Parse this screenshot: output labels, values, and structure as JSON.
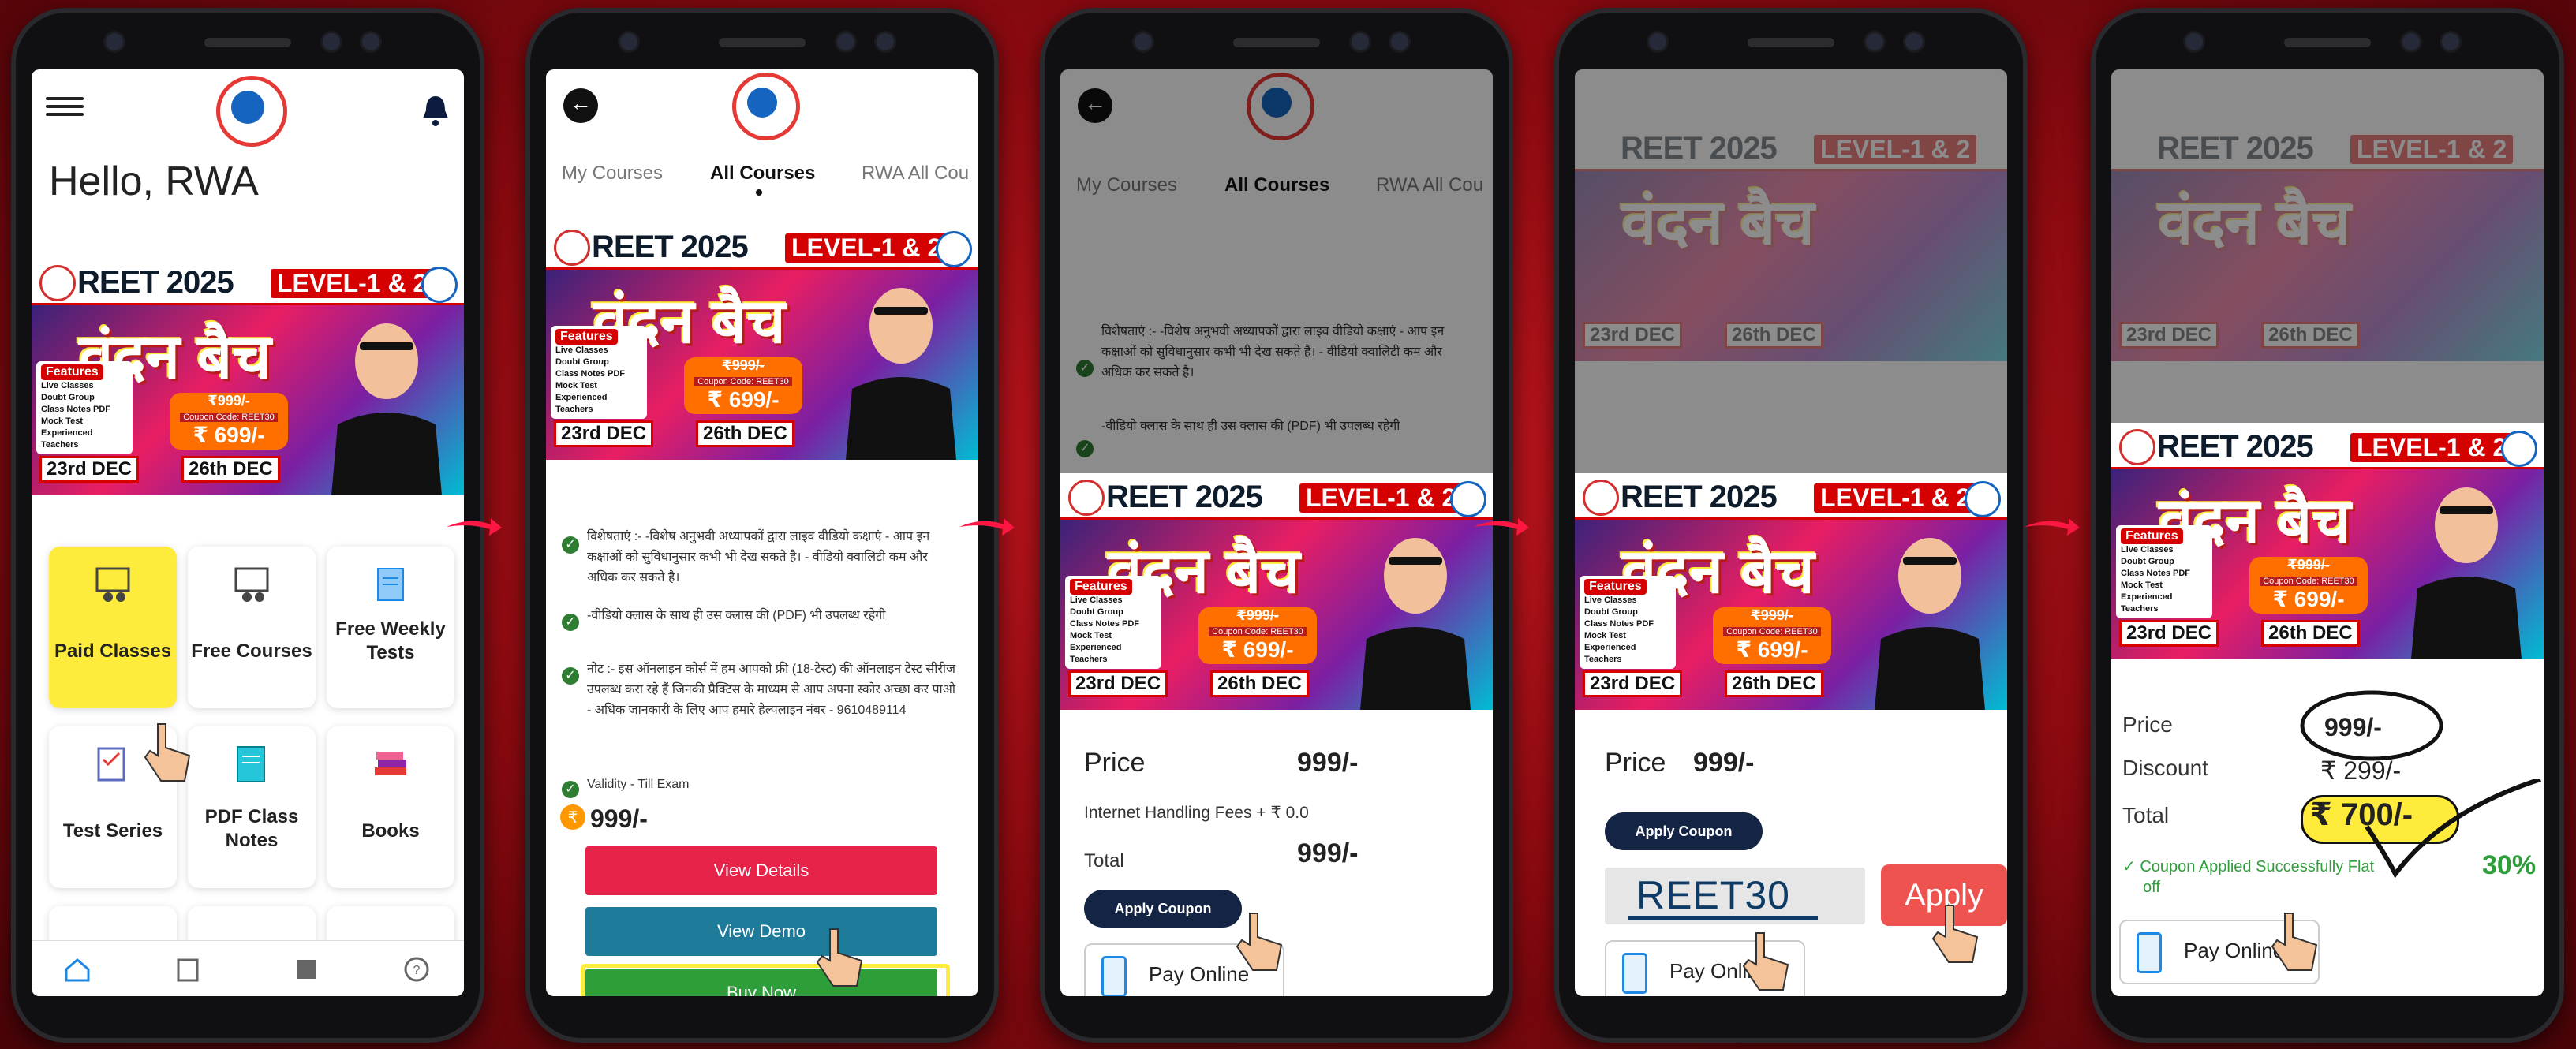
{
  "banner": {
    "reet": "REET 2025",
    "level": "LEVEL-1 & 2",
    "title": "वंदन बैच",
    "features_title": "Features",
    "features": [
      "Live Classes",
      "Doubt Group",
      "Class Notes PDF",
      "Mock Test",
      "Experienced Teachers"
    ],
    "price_old": "₹999/-",
    "coupon_line": "Coupon Code: REET30",
    "price_new": "₹ 699/-",
    "date_start": "23rd DEC",
    "date_end": "26th DEC"
  },
  "screen1": {
    "greeting": "Hello, RWA",
    "tiles": [
      {
        "label": "Paid Classes",
        "icon": "paid-classes-icon"
      },
      {
        "label": "Free Courses",
        "icon": "free-courses-icon"
      },
      {
        "label": "Free Weekly Tests",
        "icon": "weekly-tests-icon"
      },
      {
        "label": "Test Series",
        "icon": "test-series-icon"
      },
      {
        "label": "PDF Class Notes",
        "icon": "pdf-notes-icon"
      },
      {
        "label": "Books",
        "icon": "books-icon"
      }
    ]
  },
  "tabs": {
    "my_courses": "My Courses",
    "all_courses": "All Courses",
    "rwa_all": "RWA All Cou"
  },
  "screen2": {
    "para1": "विशेषताएं :- -विशेष अनुभवी अध्यापकों द्वारा लाइव वीडियो कक्षाएं - आप इन कक्षाओं को सुविधानुसार कभी भी देख सकते है। - वीडियो क्वालिटी कम और अधिक कर सकते है।",
    "para2": "-वीडियो क्लास के साथ ही उस क्लास की (PDF) भी उपलब्ध रहेगी",
    "para3": "नोट :- इस ऑनलाइन कोर्स में हम आपको फ्री (18-टेस्ट) की ऑनलाइन टेस्ट सीरीज उपलब्ध करा रहे हैं जिनकी प्रैक्टिस के माध्यम से आप अपना स्कोर अच्छा कर पाओ - अधिक जानकारी के लिए आप हमारे हेल्पलाइन नंबर - 9610489114",
    "validity": "Validity - Till Exam",
    "price": "999/-",
    "view_details": "View Details",
    "view_demo": "View Demo",
    "buy_now": "Buy Now"
  },
  "screen3": {
    "price_label": "Price",
    "price_value": "999/-",
    "fees_label": "Internet Handling Fees + ₹ 0.0",
    "total_label": "Total",
    "total_value": "999/-",
    "apply_coupon": "Apply Coupon",
    "pay_online": "Pay Online"
  },
  "screen4": {
    "price_label": "Price",
    "price_value": "999/-",
    "apply_coupon": "Apply Coupon",
    "coupon_code": "REET30",
    "apply": "Apply",
    "pay_online": "Pay Online"
  },
  "screen5": {
    "price_label": "Price",
    "price_value": "999/-",
    "discount_label": "Discount",
    "discount_value": "₹ 299/-",
    "total_label": "Total",
    "total_value": "₹ 700/-",
    "coupon_msg": "✓ Coupon Applied Successfully Flat",
    "coupon_msg2": "off",
    "coupon_pct": "30%",
    "pay_online": "Pay Online"
  },
  "colors": {
    "background": "#b8121b",
    "buy_green": "#2e9e3a",
    "view_details_red": "#e8234a",
    "view_demo_teal": "#1e7b9a",
    "coupon_navy": "#142445",
    "apply_red": "#ef5350",
    "highlight_yellow": "#ffeb3b"
  }
}
